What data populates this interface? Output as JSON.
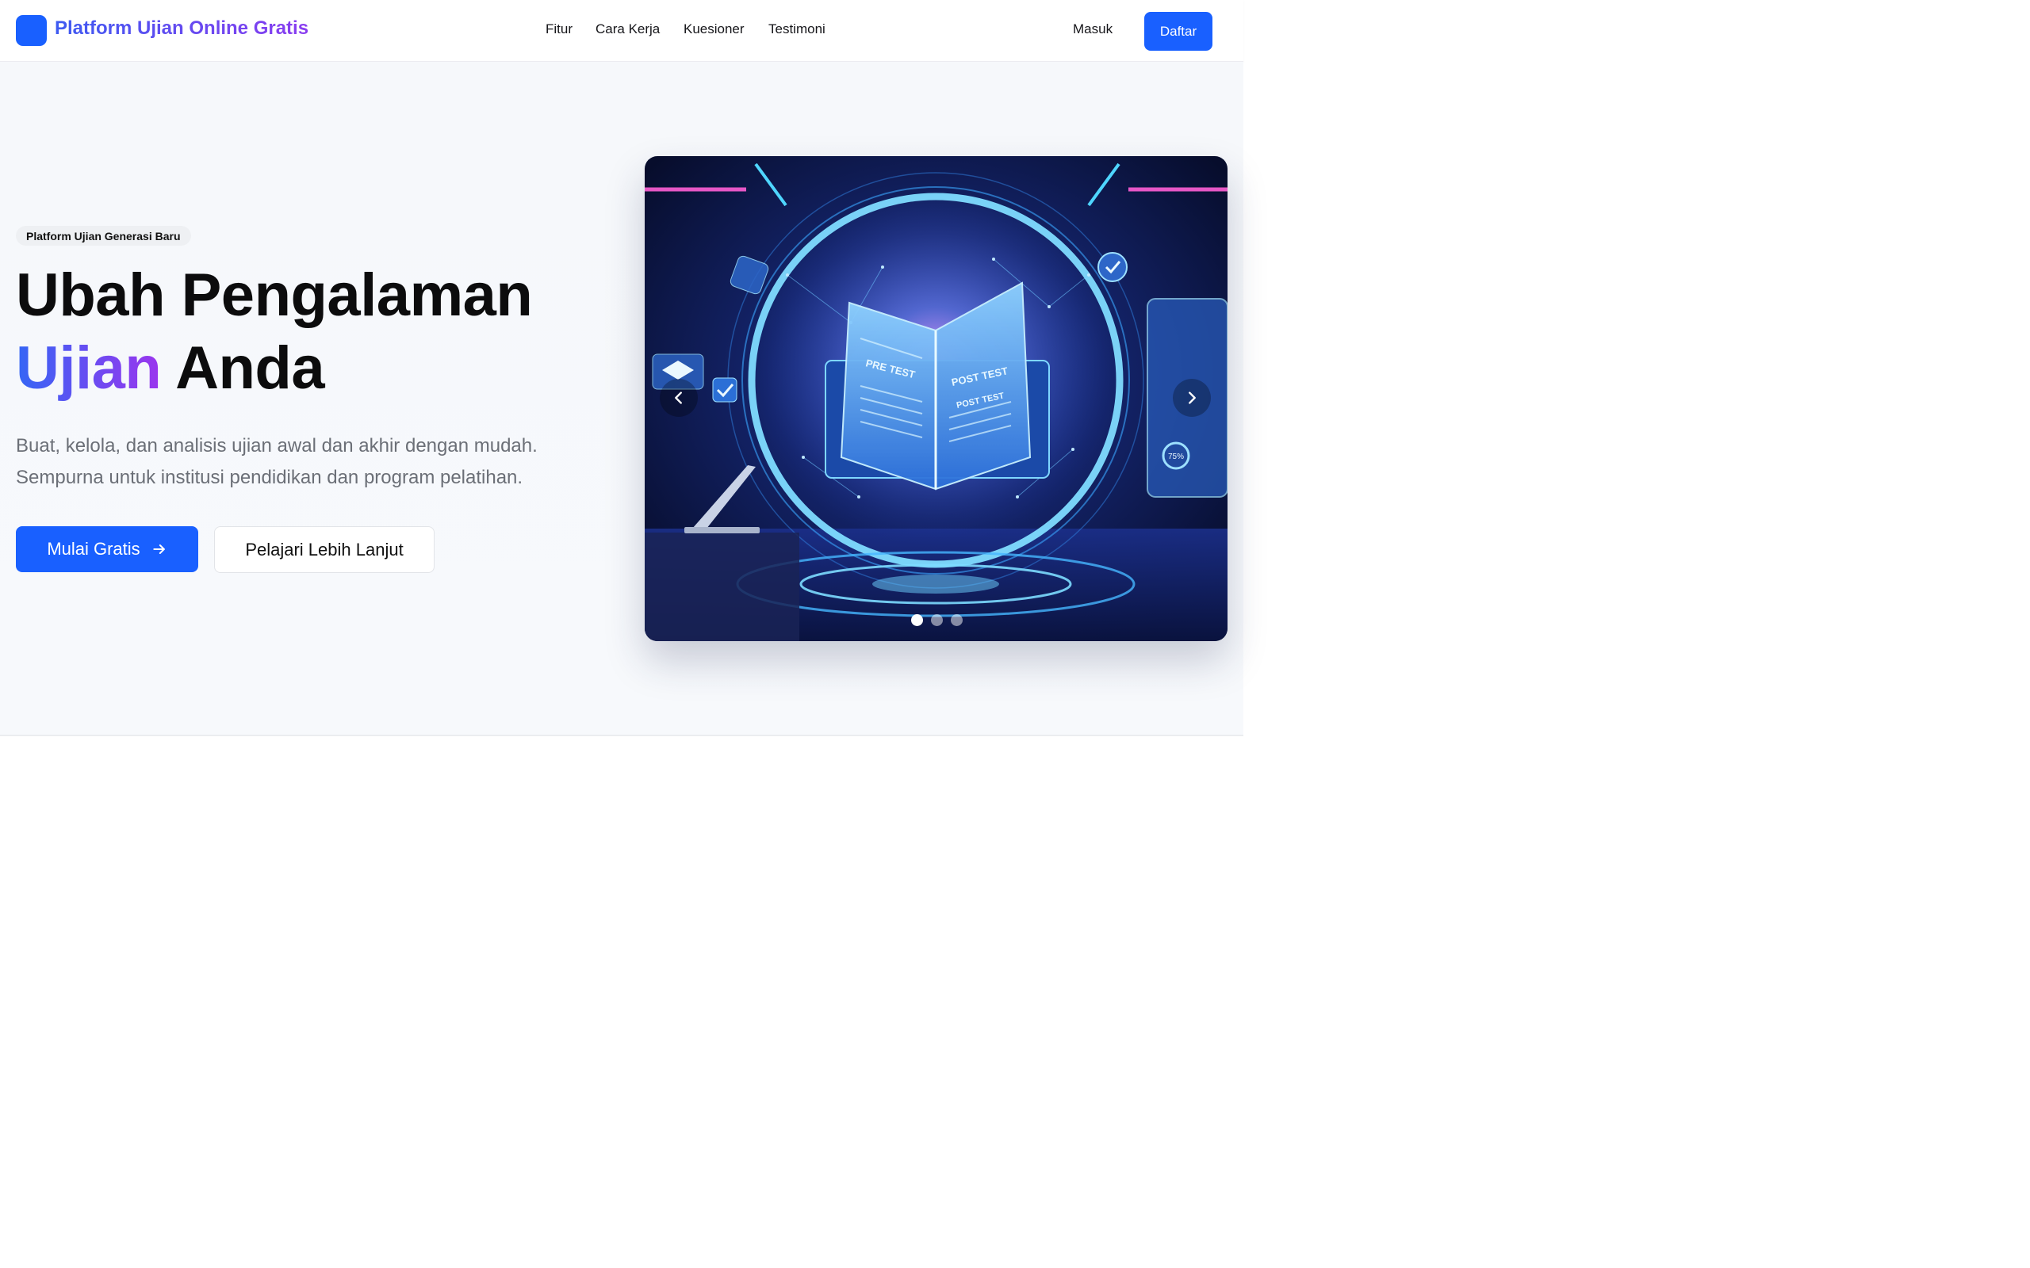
{
  "brand": {
    "name": "Platform Ujian Online Gratis",
    "color": "#1960ff"
  },
  "nav": {
    "links": [
      "Fitur",
      "Cara Kerja",
      "Kuesioner",
      "Testimoni"
    ],
    "login": "Masuk",
    "register": "Daftar"
  },
  "hero": {
    "badge": "Platform Ujian Generasi Baru",
    "title_line1": "Ubah Pengalaman",
    "title_highlight": "Ujian",
    "title_rest": "Anda",
    "subtitle": "Buat, kelola, dan analisis ujian awal dan akhir dengan mudah. Sempurna untuk institusi pendidikan dan program pelatihan.",
    "cta_primary": "Mulai Gratis",
    "cta_secondary": "Pelajari Lebih Lanjut"
  },
  "carousel": {
    "image_labels": [
      "PRE TEST",
      "POST TEST",
      "POST TEST",
      "75%"
    ],
    "slide_count": 3,
    "active_index": 0,
    "icons": [
      "chevron-left-icon",
      "chevron-right-icon",
      "arrow-right-icon"
    ]
  },
  "colors": {
    "accent": "#1960ff",
    "gradient_start": "#3466f5",
    "gradient_end": "#9b35ee"
  }
}
